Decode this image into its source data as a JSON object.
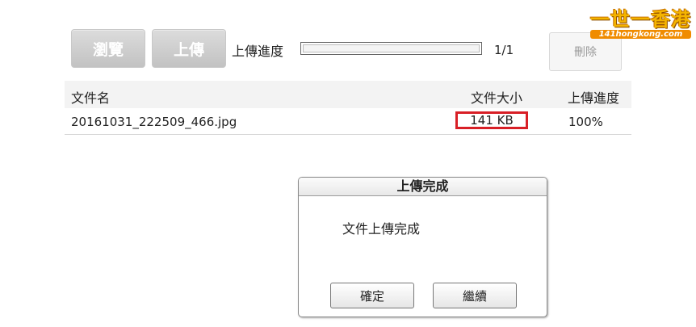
{
  "toolbar": {
    "browse_label": "瀏覽",
    "upload_label": "上傳",
    "progress_label": "上傳進度",
    "progress_fraction": 1.0,
    "counter": "1/1",
    "delete_label": "刪除"
  },
  "table": {
    "headers": {
      "name": "文件名",
      "size": "文件大小",
      "progress": "上傳進度"
    },
    "rows": [
      {
        "name": "20161031_222509_466.jpg",
        "size": "141 KB",
        "progress": "100%"
      }
    ]
  },
  "dialog": {
    "title": "上傳完成",
    "message": "文件上傳完成",
    "ok_label": "確定",
    "continue_label": "繼續"
  },
  "watermark": {
    "main": "一世一香港",
    "sub": "141hongkong.com"
  },
  "colors": {
    "highlight": "#d81f26",
    "logo": "#f4b400"
  }
}
